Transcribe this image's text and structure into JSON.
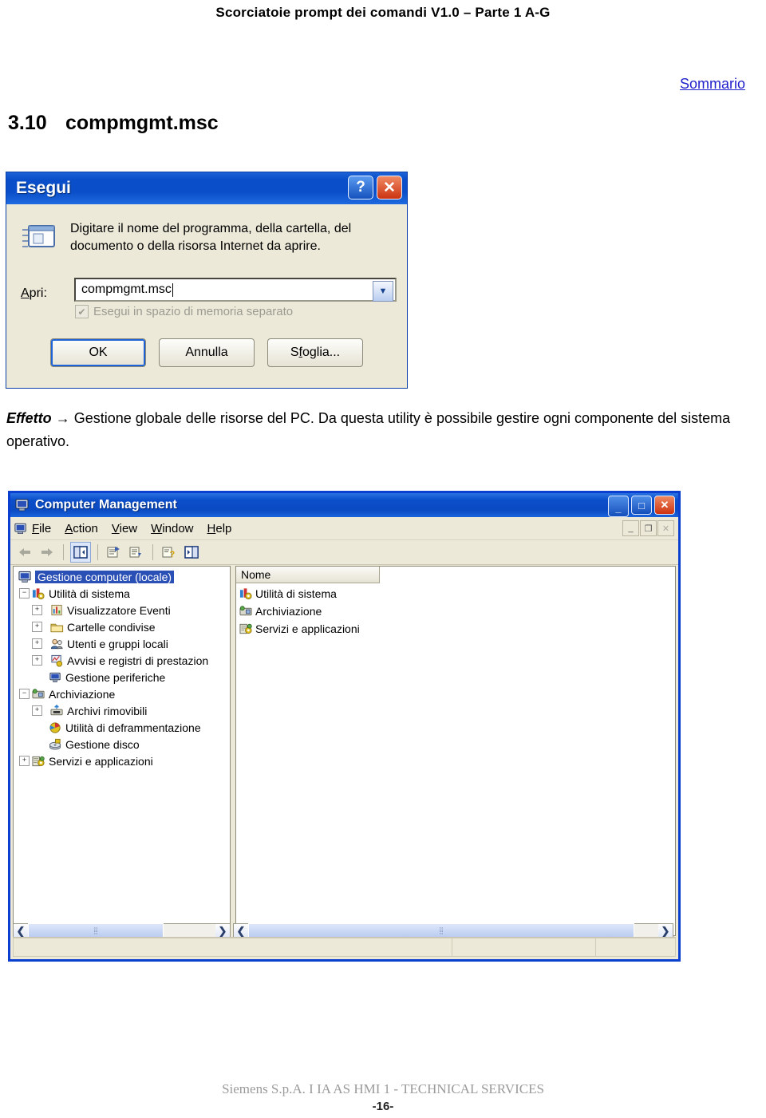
{
  "document": {
    "header": "Scorciatoie prompt dei comandi V1.0 – Parte 1 A-G",
    "toc_link": "Sommario",
    "section_number": "3.10",
    "section_title": "compmgmt.msc",
    "effect_label": "Effetto",
    "effect_arrow": "→",
    "effect_text": "Gestione globale delle risorse del PC. Da questa utility è possibile gestire ogni componente del sistema operativo.",
    "footer": "Siemens S.p.A. I IA AS HMI 1 - TECHNICAL SERVICES",
    "page_number": "-16-"
  },
  "run_dialog": {
    "title": "Esegui",
    "help_button": "?",
    "close_button": "✕",
    "prompt": "Digitare il nome del programma, della cartella, del documento o della risorsa Internet da aprire.",
    "open_label": "Apri:",
    "open_value": "compmgmt.msc",
    "separate_memory_label": "Esegui in spazio di memoria separato",
    "separate_memory_checked": true,
    "buttons": {
      "ok": "OK",
      "cancel": "Annulla",
      "browse": "Sfoglia..."
    }
  },
  "computer_management": {
    "title": "Computer Management",
    "window_buttons": {
      "minimize": "_",
      "maximize": "□",
      "close": "✕"
    },
    "mdi_buttons": {
      "minimize": "_",
      "restore": "❐",
      "close": "✕"
    },
    "menu": [
      {
        "label": "File",
        "accel": "F"
      },
      {
        "label": "Action",
        "accel": "A"
      },
      {
        "label": "View",
        "accel": "V"
      },
      {
        "label": "Window",
        "accel": "W"
      },
      {
        "label": "Help",
        "accel": "H"
      }
    ],
    "toolbar": [
      {
        "name": "back-icon",
        "glyph": "⬅"
      },
      {
        "name": "forward-icon",
        "glyph": "➡"
      },
      {
        "name": "show-hide-tree-icon",
        "glyph": "▣"
      },
      {
        "name": "properties-icon",
        "glyph": "▤"
      },
      {
        "name": "export-list-icon",
        "glyph": "▥"
      },
      {
        "name": "help-icon",
        "glyph": "?"
      },
      {
        "name": "show-console-tree-icon",
        "glyph": "▤"
      }
    ],
    "tree": [
      {
        "label": "Gestione computer (locale)",
        "level": 0,
        "expander": "",
        "icon": "computer-icon",
        "selected": true
      },
      {
        "label": "Utilità di sistema",
        "level": 1,
        "expander": "−",
        "icon": "system-tools-icon",
        "selected": false
      },
      {
        "label": "Visualizzatore Eventi",
        "level": 2,
        "expander": "+",
        "icon": "event-viewer-icon",
        "selected": false
      },
      {
        "label": "Cartelle condivise",
        "level": 2,
        "expander": "+",
        "icon": "shared-folders-icon",
        "selected": false
      },
      {
        "label": "Utenti e gruppi locali",
        "level": 2,
        "expander": "+",
        "icon": "local-users-icon",
        "selected": false
      },
      {
        "label": "Avvisi e registri di prestazion",
        "level": 2,
        "expander": "+",
        "icon": "performance-logs-icon",
        "selected": false
      },
      {
        "label": "Gestione periferiche",
        "level": 2,
        "expander": "",
        "icon": "device-manager-icon",
        "selected": false
      },
      {
        "label": "Archiviazione",
        "level": 1,
        "expander": "−",
        "icon": "storage-icon",
        "selected": false
      },
      {
        "label": "Archivi rimovibili",
        "level": 2,
        "expander": "+",
        "icon": "removable-storage-icon",
        "selected": false
      },
      {
        "label": "Utilità di deframmentazione",
        "level": 2,
        "expander": "",
        "icon": "defragmenter-icon",
        "selected": false
      },
      {
        "label": "Gestione disco",
        "level": 2,
        "expander": "",
        "icon": "disk-management-icon",
        "selected": false
      },
      {
        "label": "Servizi e applicazioni",
        "level": 1,
        "expander": "+",
        "icon": "services-apps-icon",
        "selected": false
      }
    ],
    "list": {
      "column_header": "Nome",
      "rows": [
        {
          "label": "Utilità di sistema",
          "icon": "system-tools-icon"
        },
        {
          "label": "Archiviazione",
          "icon": "storage-icon"
        },
        {
          "label": "Servizi e applicazioni",
          "icon": "services-apps-icon"
        }
      ]
    },
    "scrollbars": {
      "left_arrow": "❮",
      "right_arrow": "❯",
      "grip": "⦙⦙"
    },
    "status_bar": [
      "",
      "",
      ""
    ]
  },
  "colors": {
    "titlebar_blue": "#0a4fc9",
    "window_border": "#0b3fd0",
    "face": "#ece9d8",
    "selection": "#2a4fb5",
    "link": "#2222cc",
    "close_red": "#cd3310"
  }
}
